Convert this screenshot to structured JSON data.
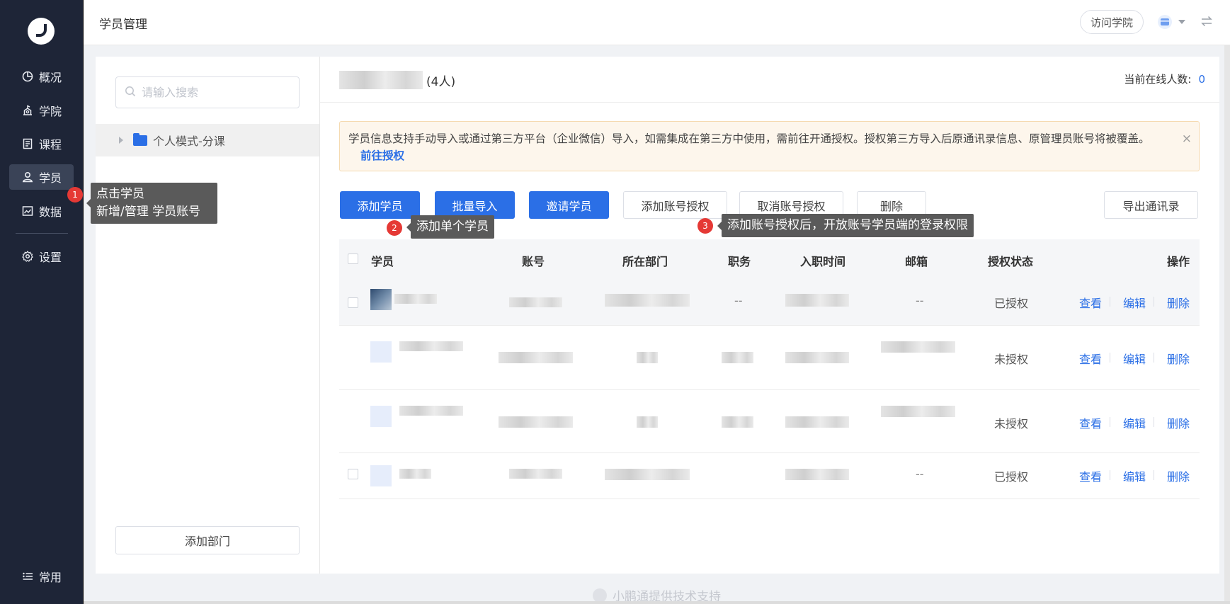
{
  "sidebar": {
    "items": [
      {
        "label": "概况",
        "icon": "pie-chart-icon"
      },
      {
        "label": "学院",
        "icon": "school-icon"
      },
      {
        "label": "课程",
        "icon": "document-icon"
      },
      {
        "label": "学员",
        "icon": "user-icon"
      },
      {
        "label": "数据",
        "icon": "image-chart-icon"
      },
      {
        "label": "设置",
        "icon": "gear-icon"
      }
    ],
    "bottom_label": "常用"
  },
  "header": {
    "title": "学员管理",
    "visit_button": "访问学院"
  },
  "left_panel": {
    "search_placeholder": "请输入搜索",
    "tree_node": "个人模式-分课",
    "add_department": "添加部门"
  },
  "main": {
    "group_count": "(4人)",
    "online_label": "当前在线人数:",
    "online_value": "0",
    "notice_text": "学员信息支持手动导入或通过第三方平台（企业微信）导入，如需集成在第三方中使用，需前往开通授权。授权第三方导入后原通讯录信息、原管理员账号将被覆盖。",
    "notice_link": "前往授权",
    "notice_close": "×",
    "buttons": {
      "add_student": "添加学员",
      "batch_import": "批量导入",
      "invite_student": "邀请学员",
      "add_auth": "添加账号授权",
      "cancel_auth": "取消账号授权",
      "delete": "删除",
      "export": "导出通讯录"
    },
    "columns": [
      "学员",
      "账号",
      "所在部门",
      "职务",
      "入职时间",
      "邮箱",
      "授权状态",
      "操作"
    ],
    "rows": [
      {
        "position": "--",
        "email": "--",
        "status": "已授权"
      },
      {
        "position": "",
        "email": "",
        "status": "未授权"
      },
      {
        "position": "",
        "email": "",
        "status": "未授权"
      },
      {
        "position": "",
        "email": "--",
        "status": "已授权"
      }
    ],
    "actions": {
      "view": "查看",
      "edit": "编辑",
      "delete": "删除"
    }
  },
  "tips": [
    {
      "badge": "1",
      "line1": "点击学员",
      "line2": "新增/管理 学员账号"
    },
    {
      "badge": "2",
      "text": "添加单个学员"
    },
    {
      "badge": "3",
      "text": "添加账号授权后，开放账号学员端的登录权限"
    }
  ],
  "footer": "小鹏通提供技术支持",
  "colors": {
    "sidebar": "#1e2537",
    "primary": "#2b6fe6",
    "notice_bg": "#fdf6ec",
    "badge": "#e53935"
  }
}
